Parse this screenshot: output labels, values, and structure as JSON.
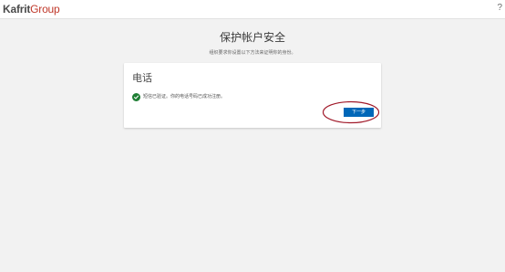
{
  "header": {
    "logo_main": "Kafrit",
    "logo_accent": "Group",
    "help_label": "?"
  },
  "page": {
    "title": "保护帐户安全",
    "subtitle": "组织要求你设置以下方法来证明你的身份。"
  },
  "card": {
    "title": "电话",
    "status_text": "短信已验证。你的电话号码已成功注册。",
    "next_button_label": "下一步"
  },
  "colors": {
    "accent": "#0067b8",
    "success": "#1e7e34",
    "logo_red": "#c0392b",
    "annotation_circle": "#a11a2a"
  },
  "icons": {
    "status": "check-circle-icon",
    "help": "help-icon"
  }
}
